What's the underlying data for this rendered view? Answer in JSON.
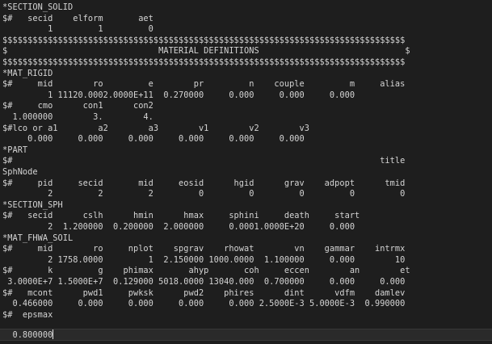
{
  "editor": {
    "lines": [
      "*SECTION_SOLID",
      "$#   secid    elform       aet",
      "         1         1         0",
      "$$$$$$$$$$$$$$$$$$$$$$$$$$$$$$$$$$$$$$$$$$$$$$$$$$$$$$$$$$$$$$$$$$$$$$$$$$$$$$$$",
      "$                              MATERIAL DEFINITIONS                             $",
      "$$$$$$$$$$$$$$$$$$$$$$$$$$$$$$$$$$$$$$$$$$$$$$$$$$$$$$$$$$$$$$$$$$$$$$$$$$$$$$$$",
      "*MAT_RIGID",
      "$#     mid        ro         e        pr         n    couple         m     alias",
      "         1 11120.0002.0000E+11  0.270000     0.000     0.000     0.000",
      "$#     cmo      con1      con2",
      "  1.000000        3.        4.",
      "$#lco or a1        a2        a3        v1        v2        v3",
      "     0.000     0.000     0.000     0.000     0.000     0.000",
      "*PART",
      "$#                                                                         title",
      "SphNode",
      "$#     pid     secid       mid     eosid      hgid      grav    adpopt      tmid",
      "         2         2         2         0         0         0         0         0",
      "*SECTION_SPH",
      "$#   secid      cslh      hmin      hmax     sphini     death     start",
      "         2  1.200000  0.200000  2.000000     0.0001.0000E+20     0.000",
      "*MAT_FHWA_SOIL",
      "$#     mid        ro     nplot    spgrav    rhowat        vn    gammar    intrmx",
      "         2 1758.0000         1  2.150000 1000.0000  1.100000     0.000        10",
      "$#       k         g    phimax       ahyp       coh     eccen        an        et",
      " 3.0000E+7 1.5000E+7  0.129000 5018.0000 13040.000  0.700000     0.000     0.000",
      "$#   mcont      pwd1     pwksk      pwd2    phires      dint      vdfm    damlev",
      "  0.466000     0.000     0.000     0.000     0.000 2.5000E-3 5.0000E-3  0.990000",
      "$#  epsmax",
      "  0.800000"
    ]
  }
}
